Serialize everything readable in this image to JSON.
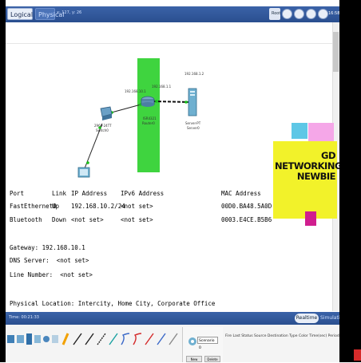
{
  "topbar": {
    "logical_tab": "Logical",
    "physical_tab": "Physical",
    "info": "x: 127, y: 26",
    "root_label": "Root",
    "clock": "16:58"
  },
  "canvas": {
    "labels": {
      "ip_router_left": "192.168.10.1",
      "ip_router_right": "192.168.1.1",
      "ip_server": "192.168.1.2",
      "router_model": "ISR4321",
      "router_name": "Router0",
      "switch_model": "2960-24TT",
      "switch_name": "Switch0",
      "server_model": "Server-PT",
      "server_name": "Server0"
    }
  },
  "port_table": {
    "headers": [
      "Port",
      "Link",
      "IP Address",
      "IPv6 Address",
      "MAC Address"
    ],
    "rows": [
      [
        "FastEthernet0",
        "Up",
        "192.168.10.2/24",
        "<not set>",
        "00D0.BA48.5A0D"
      ],
      [
        "Bluetooth",
        "Down",
        "<not set>",
        "<not set>",
        "0003.E4CE.B5B6"
      ]
    ],
    "gateway": "Gateway: 192.168.10.1",
    "dns": "DNS Server:  <not set>",
    "line_number": "Line Number:  <not set>",
    "location": "Physical Location: Intercity, Home City, Corporate Office"
  },
  "banner": {
    "text": "GD\nNETWORKING\nNEWBIE"
  },
  "bottombar": {
    "time": "Time: 00:21:33",
    "realtime": "Realtime",
    "simulation": "Simulation"
  },
  "pdu_panel": {
    "scenario": "Scenario 0",
    "columns": "Fire   Last Status   Source   Destination   Type   Color   Time(sec)   Periodic   Num   Edit",
    "new_label": "New",
    "delete_label": "Delete"
  },
  "colors": {
    "toolbar": "#2f5699",
    "green_highlight": "#3fd43f",
    "banner_yellow": "#f2f22a",
    "cyan": "#5ec7e6",
    "pink": "#f5a7e8",
    "magenta": "#d01e8e"
  }
}
